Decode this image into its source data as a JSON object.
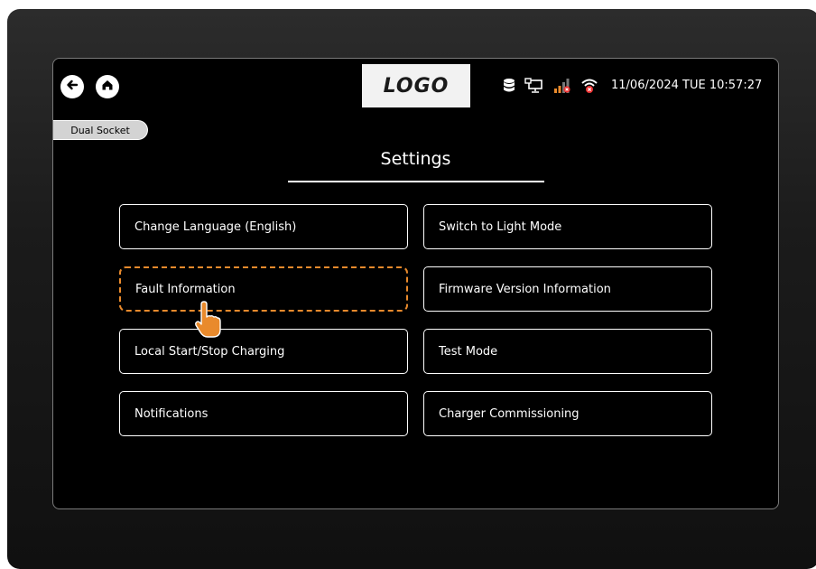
{
  "header": {
    "back_icon": "arrow-left-icon",
    "home_icon": "home-icon",
    "logo_text": "LOGO",
    "status_icons": [
      "database-icon",
      "computer-network-icon",
      "cellular-signal-icon",
      "wifi-error-icon"
    ],
    "datetime": "11/06/2024 TUE 10:57:27"
  },
  "socket_chip": {
    "label": "Dual Socket"
  },
  "page": {
    "title": "Settings"
  },
  "menu": {
    "items": [
      {
        "label": "Change Language (English)"
      },
      {
        "label": "Switch to Light Mode"
      },
      {
        "label": "Fault Information"
      },
      {
        "label": "Firmware Version Information"
      },
      {
        "label": "Local Start/Stop Charging"
      },
      {
        "label": "Test Mode"
      },
      {
        "label": "Notifications"
      },
      {
        "label": "Charger Commissioning"
      }
    ]
  },
  "focus": {
    "highlight_color": "#e98a2c",
    "pointer_icon": "hand-pointer-icon"
  },
  "colors": {
    "background": "#000000",
    "foreground": "#ffffff",
    "accent": "#e98a2c"
  }
}
